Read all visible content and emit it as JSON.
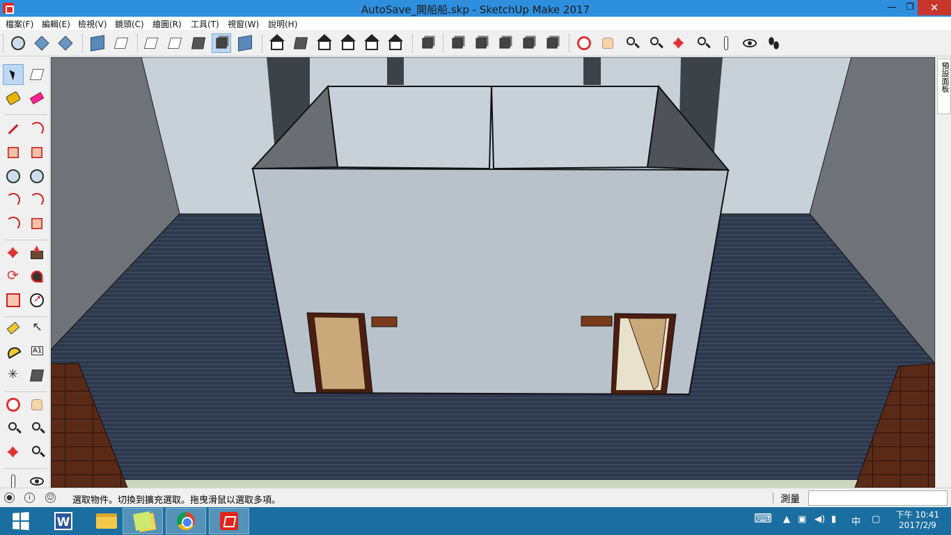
{
  "window": {
    "title": "AutoSave_開船船.skp - SketchUp Make 2017",
    "minimize_glyph": "—",
    "restore_glyph": "❐",
    "close_glyph": "✕"
  },
  "menu": [
    "檔案(F)",
    "編輯(E)",
    "檢視(V)",
    "鏡頭(C)",
    "繪圖(R)",
    "工具(T)",
    "視窗(W)",
    "說明(H)"
  ],
  "right_panel": {
    "tab_label": "預設面板"
  },
  "statusbar": {
    "message": "選取物件。切換到擴充選取。拖曳滑鼠以選取多項。",
    "measure_label": "測量",
    "measure_value": "",
    "icons": [
      "geo-location-icon",
      "credits-icon",
      "user-icon"
    ]
  },
  "taskbar": {
    "apps": [
      "start",
      "word",
      "file-explorer",
      "sticky-notes",
      "chrome",
      "sketchup"
    ],
    "active_app": "sketchup",
    "ime": "中",
    "time": "下午 10:41",
    "date": "2017/2/9"
  },
  "colors": {
    "titlebar": "#2f8fdf",
    "close_button": "#c7362b",
    "taskbar": "#1b6ea0",
    "wall": "#b9c2cb",
    "floor": "#2f3a4f"
  }
}
